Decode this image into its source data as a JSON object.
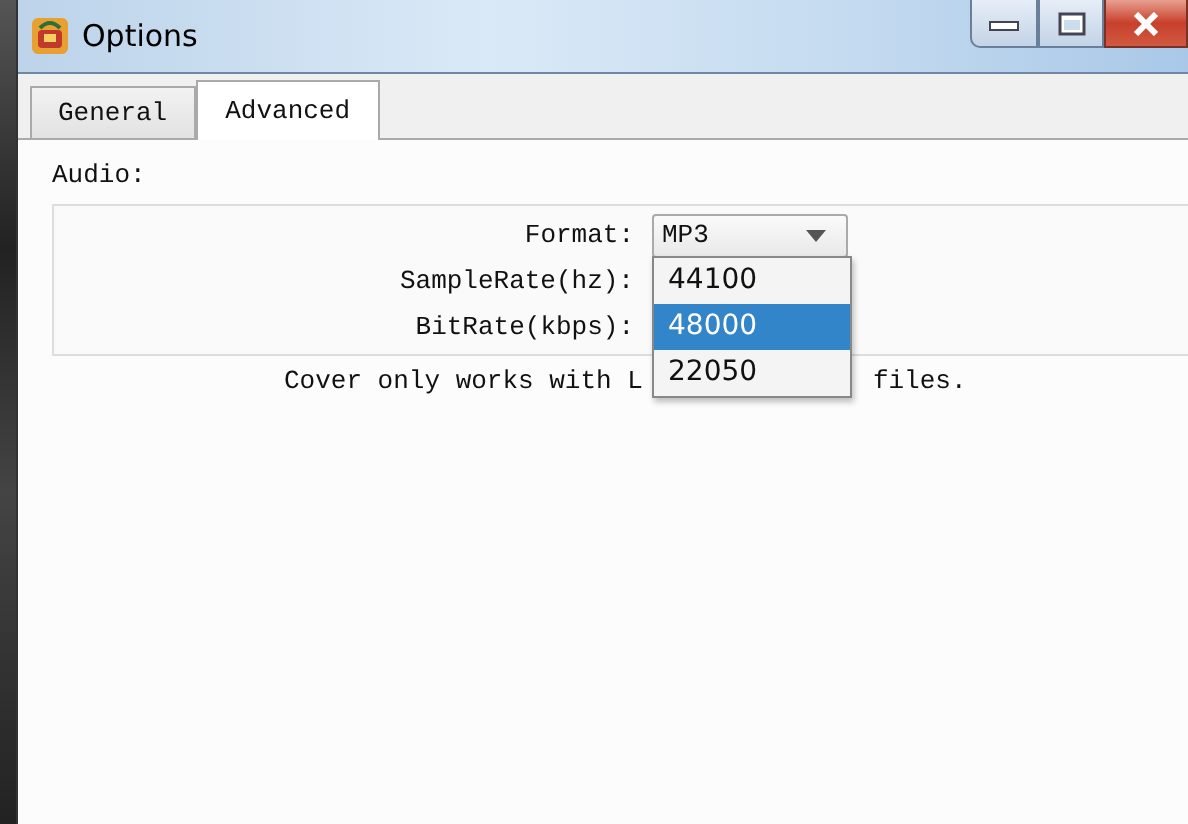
{
  "window": {
    "title": "Options"
  },
  "tabs": [
    {
      "label": "General",
      "selected": false
    },
    {
      "label": "Advanced",
      "selected": true
    }
  ],
  "section": {
    "label": "Audio:"
  },
  "fields": [
    {
      "label": "Format:",
      "kind": "combo",
      "value": "MP3"
    },
    {
      "label": "SampleRate(hz):",
      "kind": "label"
    },
    {
      "label": "BitRate(kbps):",
      "kind": "label"
    }
  ],
  "dropdown": {
    "options": [
      {
        "label": "44100",
        "selected": false
      },
      {
        "label": "48000",
        "selected": true
      },
      {
        "label": "22050",
        "selected": false
      }
    ]
  },
  "note": {
    "text_before": "Cover only works with L",
    "text_after": "files."
  }
}
